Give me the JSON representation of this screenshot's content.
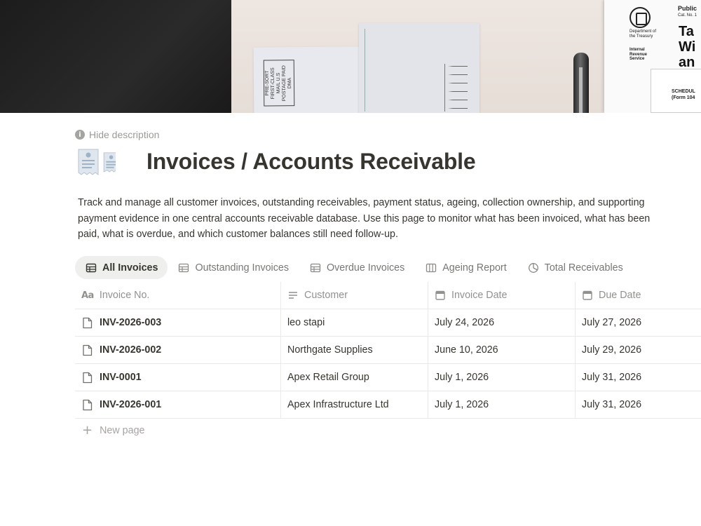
{
  "cover": {
    "stamp_text": "PRE-SORT FIRST-CLASS MAIL U.S POSTAGE PAID DMA",
    "doc_header": "Public",
    "doc_cat": "Cat. No. 1",
    "doc_dept": "Department of the Treasury",
    "doc_irs": "Internal Revenue Service",
    "doc_title": "Ta Wi an",
    "doc_schedule": "SCHEDUL (Form 104"
  },
  "header": {
    "toggle_label": "Hide description",
    "title": "Invoices / Accounts Receivable",
    "description": "Track and manage all customer invoices, outstanding receivables, payment status, ageing, collection ownership, and supporting payment evidence in one central accounts receivable database. Use this page to monitor what has been invoiced, what has been paid, what is overdue, and which customer balances still need follow-up."
  },
  "tabs": [
    {
      "label": "All Invoices",
      "icon": "table-icon",
      "active": true
    },
    {
      "label": "Outstanding Invoices",
      "icon": "table-icon",
      "active": false
    },
    {
      "label": "Overdue Invoices",
      "icon": "table-icon",
      "active": false
    },
    {
      "label": "Ageing Report",
      "icon": "board-icon",
      "active": false
    },
    {
      "label": "Total Receivables",
      "icon": "chart-icon",
      "active": false
    }
  ],
  "table": {
    "columns": [
      {
        "label": "Invoice No.",
        "icon": "title-aa-icon"
      },
      {
        "label": "Customer",
        "icon": "text-lines-icon"
      },
      {
        "label": "Invoice Date",
        "icon": "calendar-icon"
      },
      {
        "label": "Due Date",
        "icon": "calendar-icon"
      }
    ],
    "rows": [
      {
        "invoice_no": "INV-2026-003",
        "customer": "leo stapi",
        "invoice_date": "July 24, 2026",
        "due_date": "July 27, 2026"
      },
      {
        "invoice_no": "INV-2026-002",
        "customer": "Northgate Supplies",
        "invoice_date": "June 10, 2026",
        "due_date": "July 29, 2026"
      },
      {
        "invoice_no": "INV-0001",
        "customer": "Apex Retail Group",
        "invoice_date": "July 1, 2026",
        "due_date": "July 31, 2026"
      },
      {
        "invoice_no": "INV-2026-001",
        "customer": "Apex Infrastructure Ltd",
        "invoice_date": "July 1, 2026",
        "due_date": "July 31, 2026"
      }
    ],
    "new_page_label": "New page"
  }
}
